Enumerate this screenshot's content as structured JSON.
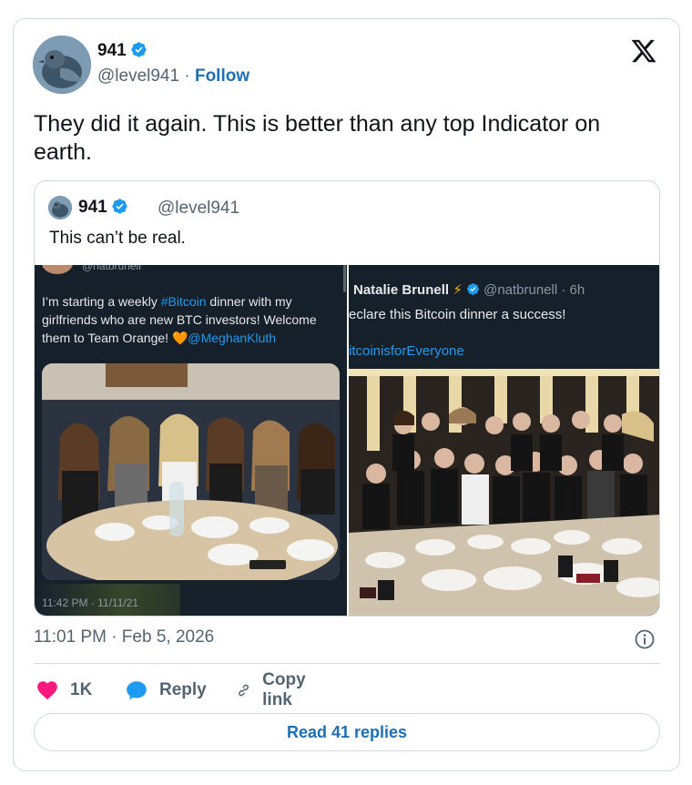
{
  "author": {
    "name": "941",
    "handle": "@level941",
    "separator": " · ",
    "follow_label": "Follow"
  },
  "tweet": {
    "text": "They did it again. This is better than any top Indicator on earth.",
    "timestamp": "11:01 PM · Feb 5, 2026"
  },
  "quoted": {
    "name": "941",
    "handle": "@level941",
    "text": "This can’t be real.",
    "left_shot": {
      "handle_partial": "@natbrunell",
      "text_before_tag": "I’m starting a weekly ",
      "tag": "#Bitcoin",
      "text_after_tag": " dinner with my girlfriends who are new BTC investors! Welcome them to Team Orange! ",
      "heart": "🧡",
      "mention": "@MeghanKluth",
      "time": "11:42 PM · 11/11/21"
    },
    "right_shot": {
      "name": "Natalie Brunell",
      "bolt": "⚡",
      "handle_time": "@natbrunell · 6h",
      "text": "eclare this Bitcoin dinner a success!",
      "tag": "itcoinisforEveryone"
    }
  },
  "actions": {
    "like_count": "1K",
    "reply_label": "Reply",
    "copy_label": "Copy link",
    "read_replies_label": "Read 41 replies"
  },
  "colors": {
    "like": "#f91880",
    "reply": "#1d9bf0",
    "link": "#1d6fb8",
    "verified": "#1d9bf0"
  },
  "icons": [
    "x-logo-icon",
    "verified-badge-icon",
    "info-icon",
    "heart-icon",
    "reply-bubble-icon",
    "link-icon"
  ]
}
